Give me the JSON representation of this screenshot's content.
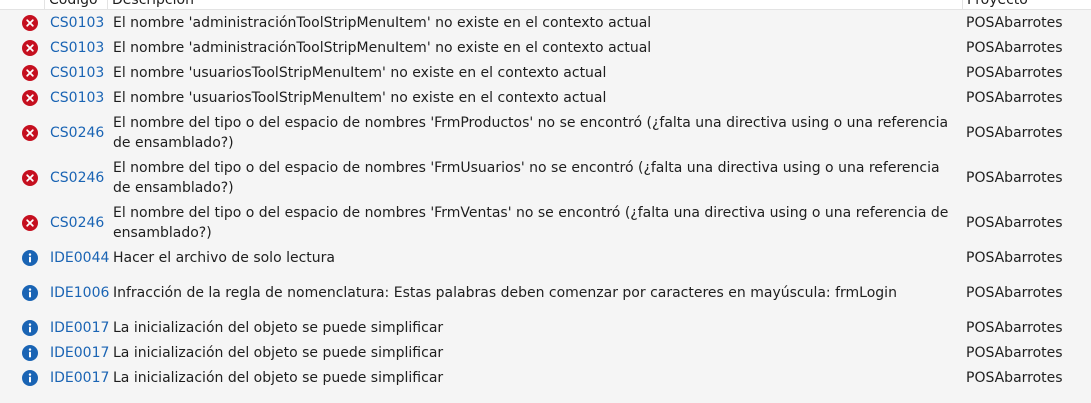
{
  "header": {
    "code_label": "Código",
    "description_label": "Descripción",
    "project_label": "Proyecto"
  },
  "colors": {
    "error": "#c50f1f",
    "info": "#1a64b4",
    "link": "#1a64b4",
    "background": "#f5f5f5"
  },
  "rows": [
    {
      "severity": "error",
      "icon": "error-icon",
      "code": "CS0103",
      "description": "El nombre 'administraciónToolStripMenuItem' no existe en el contexto actual",
      "project": "POSAbarrotes"
    },
    {
      "severity": "error",
      "icon": "error-icon",
      "code": "CS0103",
      "description": "El nombre 'administraciónToolStripMenuItem' no existe en el contexto actual",
      "project": "POSAbarrotes"
    },
    {
      "severity": "error",
      "icon": "error-icon",
      "code": "CS0103",
      "description": "El nombre 'usuariosToolStripMenuItem' no existe en el contexto actual",
      "project": "POSAbarrotes"
    },
    {
      "severity": "error",
      "icon": "error-icon",
      "code": "CS0103",
      "description": "El nombre 'usuariosToolStripMenuItem' no existe en el contexto actual",
      "project": "POSAbarrotes"
    },
    {
      "severity": "error",
      "icon": "error-icon",
      "code": "CS0246",
      "description": "El nombre del tipo o del espacio de nombres 'FrmProductos' no se encontró (¿falta una directiva using o una referencia de ensamblado?)",
      "project": "POSAbarrotes"
    },
    {
      "severity": "error",
      "icon": "error-icon",
      "code": "CS0246",
      "description": "El nombre del tipo o del espacio de nombres 'FrmUsuarios' no se encontró (¿falta una directiva using o una referencia de ensamblado?)",
      "project": "POSAbarrotes"
    },
    {
      "severity": "error",
      "icon": "error-icon",
      "code": "CS0246",
      "description": "El nombre del tipo o del espacio de nombres 'FrmVentas' no se encontró (¿falta una directiva using o una referencia de ensamblado?)",
      "project": "POSAbarrotes"
    },
    {
      "severity": "info",
      "icon": "info-icon",
      "code": "IDE0044",
      "description": "Hacer el archivo de solo lectura",
      "project": "POSAbarrotes"
    },
    {
      "severity": "info",
      "icon": "info-icon",
      "code": "IDE1006",
      "description": "Infracción de la regla de nomenclatura: Estas palabras deben comenzar por caracteres en mayúscula: frmLogin",
      "project": "POSAbarrotes"
    },
    {
      "severity": "info",
      "icon": "info-icon",
      "code": "IDE0017",
      "description": "La inicialización del objeto se puede simplificar",
      "project": "POSAbarrotes"
    },
    {
      "severity": "info",
      "icon": "info-icon",
      "code": "IDE0017",
      "description": "La inicialización del objeto se puede simplificar",
      "project": "POSAbarrotes"
    },
    {
      "severity": "info",
      "icon": "info-icon",
      "code": "IDE0017",
      "description": "La inicialización del objeto se puede simplificar",
      "project": "POSAbarrotes"
    }
  ]
}
